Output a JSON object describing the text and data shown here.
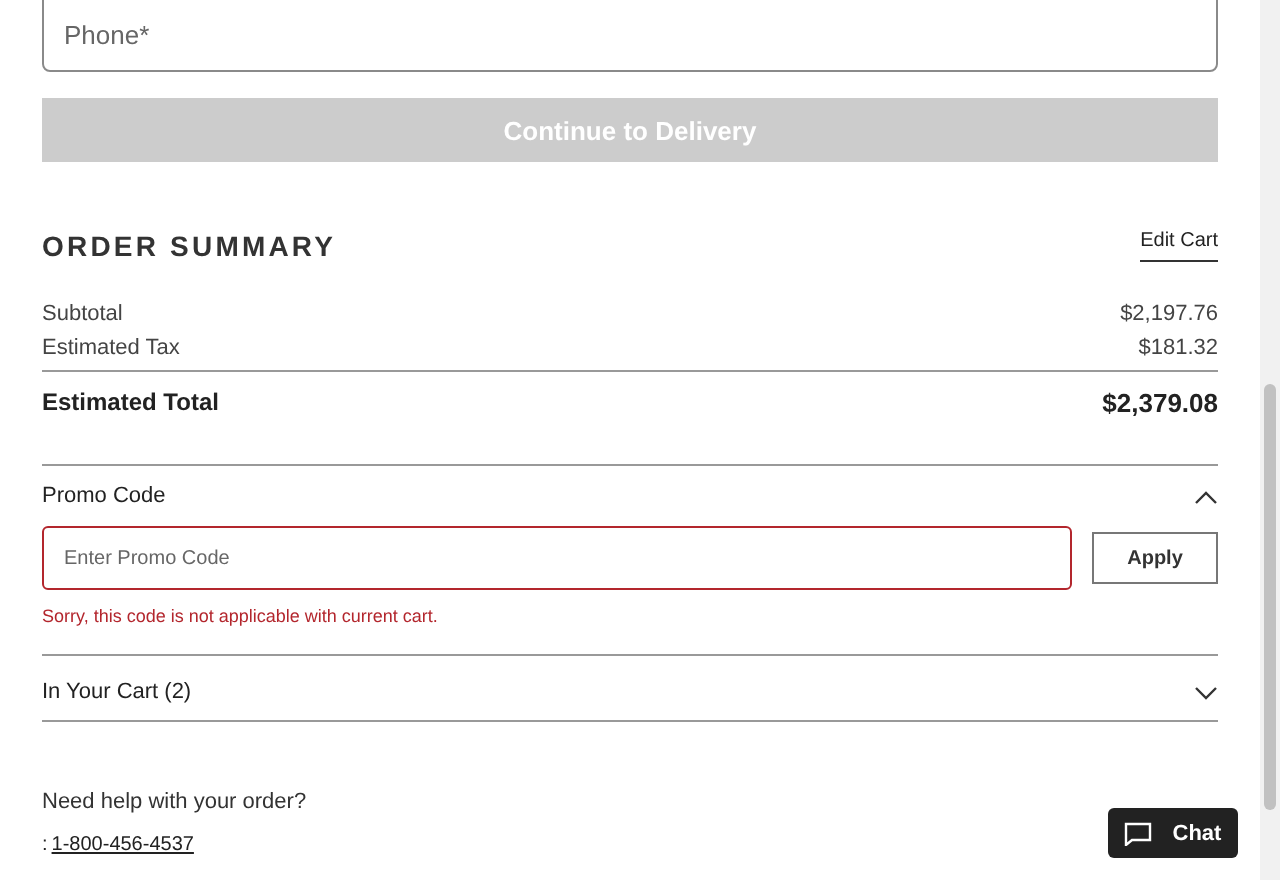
{
  "phone_field": {
    "placeholder": "Phone*"
  },
  "continue_button": {
    "label": "Continue to Delivery",
    "disabled": true
  },
  "order_summary": {
    "title": "ORDER SUMMARY",
    "edit_link": "Edit Cart",
    "lines": [
      {
        "label": "Subtotal",
        "value": "$2,197.76"
      },
      {
        "label": "Estimated Tax",
        "value": "$181.32"
      }
    ],
    "total": {
      "label": "Estimated Total",
      "value": "$2,379.08"
    }
  },
  "promo": {
    "title": "Promo Code",
    "expanded": true,
    "field": {
      "placeholder": "Enter Promo Code",
      "invalid": true
    },
    "apply_button": "Apply",
    "error": "Sorry, this code is not applicable with current cart."
  },
  "cart": {
    "title": "In Your Cart (2)",
    "expanded": false
  },
  "help": {
    "question": "Need help with your order?",
    "prefix": ":",
    "phone": "1-800-456-4537"
  },
  "chat_button": {
    "label": "Chat"
  }
}
